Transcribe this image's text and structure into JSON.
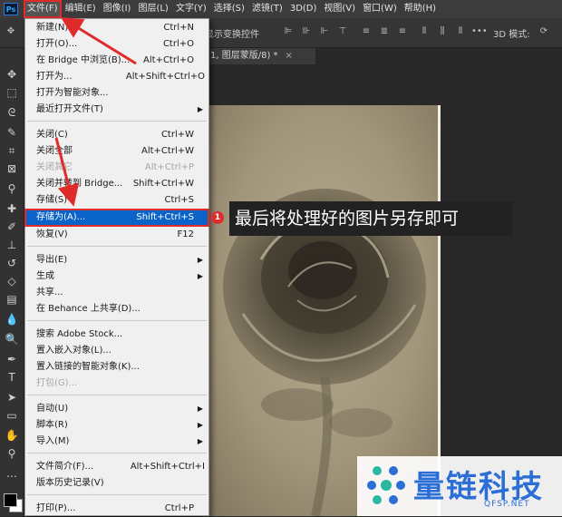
{
  "menubar": {
    "logo": "Ps",
    "items": [
      "文件(F)",
      "编辑(E)",
      "图像(I)",
      "图层(L)",
      "文字(Y)",
      "选择(S)",
      "滤镜(T)",
      "3D(D)",
      "视图(V)",
      "窗口(W)",
      "帮助(H)"
    ]
  },
  "options_bar": {
    "show_transform": "显示变换控件",
    "mode_3d": "3D 模式:"
  },
  "document_tab": {
    "title": "1, 图层蒙版/8) *",
    "close": "×"
  },
  "file_menu": {
    "items": [
      {
        "label": "新建(N)...",
        "shortcut": "Ctrl+N"
      },
      {
        "label": "打开(O)...",
        "shortcut": "Ctrl+O"
      },
      {
        "label": "在 Bridge 中浏览(B)...",
        "shortcut": "Alt+Ctrl+O"
      },
      {
        "label": "打开为...",
        "shortcut": "Alt+Shift+Ctrl+O"
      },
      {
        "label": "打开为智能对象..."
      },
      {
        "label": "最近打开文件(T)",
        "submenu": true
      },
      {
        "label": "关闭(C)",
        "shortcut": "Ctrl+W"
      },
      {
        "label": "关闭全部",
        "shortcut": "Alt+Ctrl+W"
      },
      {
        "label": "关闭其它",
        "shortcut": "Alt+Ctrl+P",
        "disabled": true
      },
      {
        "label": "关闭并转到 Bridge...",
        "shortcut": "Shift+Ctrl+W"
      },
      {
        "label": "存储(S)",
        "shortcut": "Ctrl+S"
      },
      {
        "label": "存储为(A)...",
        "shortcut": "Shift+Ctrl+S",
        "selected": true
      },
      {
        "label": "恢复(V)",
        "shortcut": "F12"
      },
      {
        "label": "导出(E)",
        "submenu": true
      },
      {
        "label": "生成",
        "submenu": true
      },
      {
        "label": "共享..."
      },
      {
        "label": "在 Behance 上共享(D)..."
      },
      {
        "label": "搜索 Adobe Stock..."
      },
      {
        "label": "置入嵌入对象(L)..."
      },
      {
        "label": "置入链接的智能对象(K)..."
      },
      {
        "label": "打包(G)...",
        "disabled": true
      },
      {
        "label": "自动(U)",
        "submenu": true
      },
      {
        "label": "脚本(R)",
        "submenu": true
      },
      {
        "label": "导入(M)",
        "submenu": true
      },
      {
        "label": "文件简介(F)...",
        "shortcut": "Alt+Shift+Ctrl+I"
      },
      {
        "label": "版本历史记录(V)"
      },
      {
        "label": "打印(P)...",
        "shortcut": "Ctrl+P"
      }
    ]
  },
  "annotation": {
    "badge": "1",
    "text": "最后将处理好的图片另存即可",
    "color": "#e02b2b"
  },
  "watermark": {
    "name": "量链科技",
    "url": "QFSP.NET"
  },
  "icons": [
    "move-icon",
    "marquee-icon",
    "lasso-icon",
    "quick-select-icon",
    "crop-icon",
    "frame-icon",
    "eyedropper-icon",
    "healing-icon",
    "brush-icon",
    "stamp-icon",
    "history-brush-icon",
    "eraser-icon",
    "gradient-icon",
    "blur-icon",
    "dodge-icon",
    "pen-icon",
    "type-icon",
    "path-select-icon",
    "rectangle-icon",
    "hand-icon",
    "zoom-icon"
  ]
}
